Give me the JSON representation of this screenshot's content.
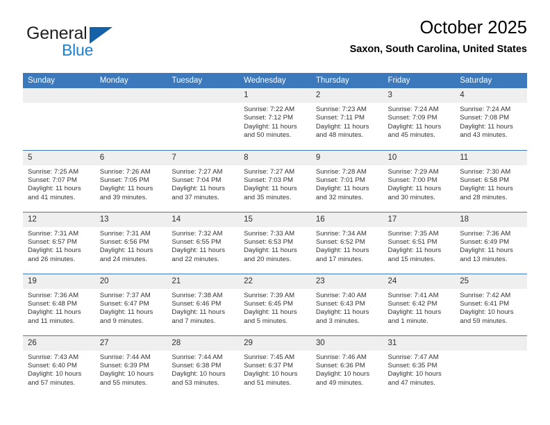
{
  "brand": {
    "name_part1": "General",
    "name_part2": "Blue",
    "logo_icon": "triangle-logo-icon"
  },
  "header": {
    "month_title": "October 2025",
    "location": "Saxon, South Carolina, United States"
  },
  "calendar": {
    "weekday_headers": [
      "Sunday",
      "Monday",
      "Tuesday",
      "Wednesday",
      "Thursday",
      "Friday",
      "Saturday"
    ],
    "accent_color": "#3b78bc",
    "daynum_bg": "#efefef",
    "weeks": [
      [
        {
          "day": "",
          "blank": true
        },
        {
          "day": "",
          "blank": true
        },
        {
          "day": "",
          "blank": true
        },
        {
          "day": "1",
          "sunrise": "Sunrise: 7:22 AM",
          "sunset": "Sunset: 7:12 PM",
          "daylight": "Daylight: 11 hours and 50 minutes."
        },
        {
          "day": "2",
          "sunrise": "Sunrise: 7:23 AM",
          "sunset": "Sunset: 7:11 PM",
          "daylight": "Daylight: 11 hours and 48 minutes."
        },
        {
          "day": "3",
          "sunrise": "Sunrise: 7:24 AM",
          "sunset": "Sunset: 7:09 PM",
          "daylight": "Daylight: 11 hours and 45 minutes."
        },
        {
          "day": "4",
          "sunrise": "Sunrise: 7:24 AM",
          "sunset": "Sunset: 7:08 PM",
          "daylight": "Daylight: 11 hours and 43 minutes."
        }
      ],
      [
        {
          "day": "5",
          "sunrise": "Sunrise: 7:25 AM",
          "sunset": "Sunset: 7:07 PM",
          "daylight": "Daylight: 11 hours and 41 minutes."
        },
        {
          "day": "6",
          "sunrise": "Sunrise: 7:26 AM",
          "sunset": "Sunset: 7:05 PM",
          "daylight": "Daylight: 11 hours and 39 minutes."
        },
        {
          "day": "7",
          "sunrise": "Sunrise: 7:27 AM",
          "sunset": "Sunset: 7:04 PM",
          "daylight": "Daylight: 11 hours and 37 minutes."
        },
        {
          "day": "8",
          "sunrise": "Sunrise: 7:27 AM",
          "sunset": "Sunset: 7:03 PM",
          "daylight": "Daylight: 11 hours and 35 minutes."
        },
        {
          "day": "9",
          "sunrise": "Sunrise: 7:28 AM",
          "sunset": "Sunset: 7:01 PM",
          "daylight": "Daylight: 11 hours and 32 minutes."
        },
        {
          "day": "10",
          "sunrise": "Sunrise: 7:29 AM",
          "sunset": "Sunset: 7:00 PM",
          "daylight": "Daylight: 11 hours and 30 minutes."
        },
        {
          "day": "11",
          "sunrise": "Sunrise: 7:30 AM",
          "sunset": "Sunset: 6:58 PM",
          "daylight": "Daylight: 11 hours and 28 minutes."
        }
      ],
      [
        {
          "day": "12",
          "sunrise": "Sunrise: 7:31 AM",
          "sunset": "Sunset: 6:57 PM",
          "daylight": "Daylight: 11 hours and 26 minutes."
        },
        {
          "day": "13",
          "sunrise": "Sunrise: 7:31 AM",
          "sunset": "Sunset: 6:56 PM",
          "daylight": "Daylight: 11 hours and 24 minutes."
        },
        {
          "day": "14",
          "sunrise": "Sunrise: 7:32 AM",
          "sunset": "Sunset: 6:55 PM",
          "daylight": "Daylight: 11 hours and 22 minutes."
        },
        {
          "day": "15",
          "sunrise": "Sunrise: 7:33 AM",
          "sunset": "Sunset: 6:53 PM",
          "daylight": "Daylight: 11 hours and 20 minutes."
        },
        {
          "day": "16",
          "sunrise": "Sunrise: 7:34 AM",
          "sunset": "Sunset: 6:52 PM",
          "daylight": "Daylight: 11 hours and 17 minutes."
        },
        {
          "day": "17",
          "sunrise": "Sunrise: 7:35 AM",
          "sunset": "Sunset: 6:51 PM",
          "daylight": "Daylight: 11 hours and 15 minutes."
        },
        {
          "day": "18",
          "sunrise": "Sunrise: 7:36 AM",
          "sunset": "Sunset: 6:49 PM",
          "daylight": "Daylight: 11 hours and 13 minutes."
        }
      ],
      [
        {
          "day": "19",
          "sunrise": "Sunrise: 7:36 AM",
          "sunset": "Sunset: 6:48 PM",
          "daylight": "Daylight: 11 hours and 11 minutes."
        },
        {
          "day": "20",
          "sunrise": "Sunrise: 7:37 AM",
          "sunset": "Sunset: 6:47 PM",
          "daylight": "Daylight: 11 hours and 9 minutes."
        },
        {
          "day": "21",
          "sunrise": "Sunrise: 7:38 AM",
          "sunset": "Sunset: 6:46 PM",
          "daylight": "Daylight: 11 hours and 7 minutes."
        },
        {
          "day": "22",
          "sunrise": "Sunrise: 7:39 AM",
          "sunset": "Sunset: 6:45 PM",
          "daylight": "Daylight: 11 hours and 5 minutes."
        },
        {
          "day": "23",
          "sunrise": "Sunrise: 7:40 AM",
          "sunset": "Sunset: 6:43 PM",
          "daylight": "Daylight: 11 hours and 3 minutes."
        },
        {
          "day": "24",
          "sunrise": "Sunrise: 7:41 AM",
          "sunset": "Sunset: 6:42 PM",
          "daylight": "Daylight: 11 hours and 1 minute."
        },
        {
          "day": "25",
          "sunrise": "Sunrise: 7:42 AM",
          "sunset": "Sunset: 6:41 PM",
          "daylight": "Daylight: 10 hours and 59 minutes."
        }
      ],
      [
        {
          "day": "26",
          "sunrise": "Sunrise: 7:43 AM",
          "sunset": "Sunset: 6:40 PM",
          "daylight": "Daylight: 10 hours and 57 minutes."
        },
        {
          "day": "27",
          "sunrise": "Sunrise: 7:44 AM",
          "sunset": "Sunset: 6:39 PM",
          "daylight": "Daylight: 10 hours and 55 minutes."
        },
        {
          "day": "28",
          "sunrise": "Sunrise: 7:44 AM",
          "sunset": "Sunset: 6:38 PM",
          "daylight": "Daylight: 10 hours and 53 minutes."
        },
        {
          "day": "29",
          "sunrise": "Sunrise: 7:45 AM",
          "sunset": "Sunset: 6:37 PM",
          "daylight": "Daylight: 10 hours and 51 minutes."
        },
        {
          "day": "30",
          "sunrise": "Sunrise: 7:46 AM",
          "sunset": "Sunset: 6:36 PM",
          "daylight": "Daylight: 10 hours and 49 minutes."
        },
        {
          "day": "31",
          "sunrise": "Sunrise: 7:47 AM",
          "sunset": "Sunset: 6:35 PM",
          "daylight": "Daylight: 10 hours and 47 minutes."
        },
        {
          "day": "",
          "blank": true
        }
      ]
    ]
  }
}
